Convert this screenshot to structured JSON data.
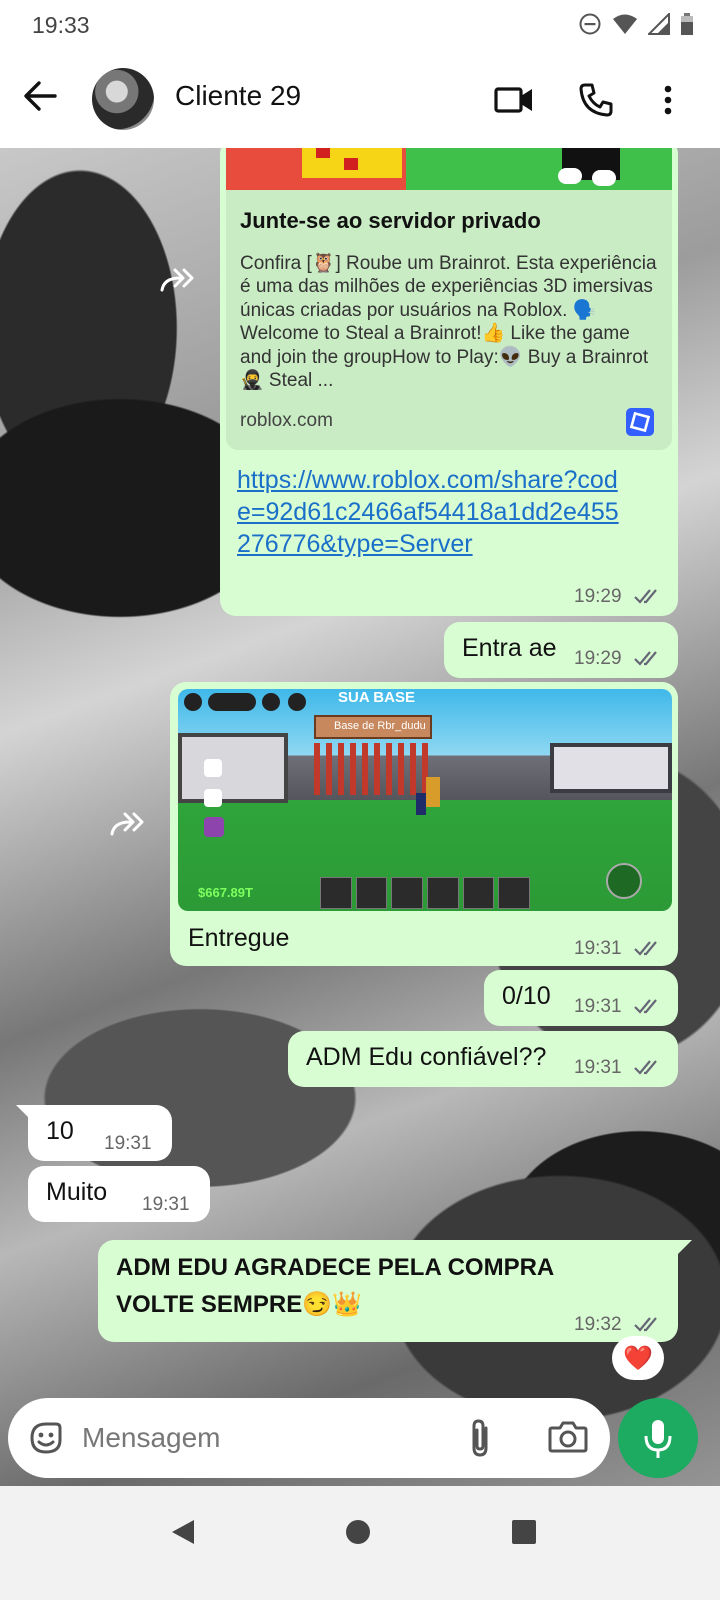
{
  "status_bar": {
    "time": "19:33"
  },
  "header": {
    "contact_name": "Cliente 29"
  },
  "messages": {
    "link_preview": {
      "title": "Junte-se ao servidor privado",
      "description": "Confira [🦉] Roube um Brainrot. Esta experiência é uma das milhões de experiências 3D imersivas únicas criadas por usuários na Roblox. 🗣️ Welcome to Steal a Brainrot!👍 Like the game and join the groupHow to Play:👽 Buy a Brainrot🥷 Steal ...",
      "domain": "roblox.com",
      "url": "https://www.roblox.com/share?code=92d61c2466af54418a1dd2e455276776&type=Server",
      "time": "19:29"
    },
    "m_entra": {
      "text": "Entra ae",
      "time": "19:29"
    },
    "m_image": {
      "caption": "Entregue",
      "time": "19:31",
      "game_base_title": "SUA BASE",
      "game_sign": "Base de Rbr_dudu",
      "game_money": "$667.89T"
    },
    "m_score": {
      "text": "0/10",
      "time": "19:31"
    },
    "m_question": {
      "text": "ADM Edu confiável??",
      "time": "19:31"
    },
    "m_10": {
      "text": "10",
      "time": "19:31"
    },
    "m_muito": {
      "text": "Muito",
      "time": "19:31"
    },
    "m_final": {
      "line1": "ADM EDU AGRADECE PELA COMPRA",
      "line2": "VOLTE SEMPRE😏👑",
      "time": "19:32",
      "reaction": "❤️"
    }
  },
  "input": {
    "placeholder": "Mensagem"
  },
  "colors": {
    "outgoing_bubble": "#d9fdd3",
    "incoming_bubble": "#ffffff",
    "accent": "#1daa61",
    "link": "#1a6fc9"
  }
}
